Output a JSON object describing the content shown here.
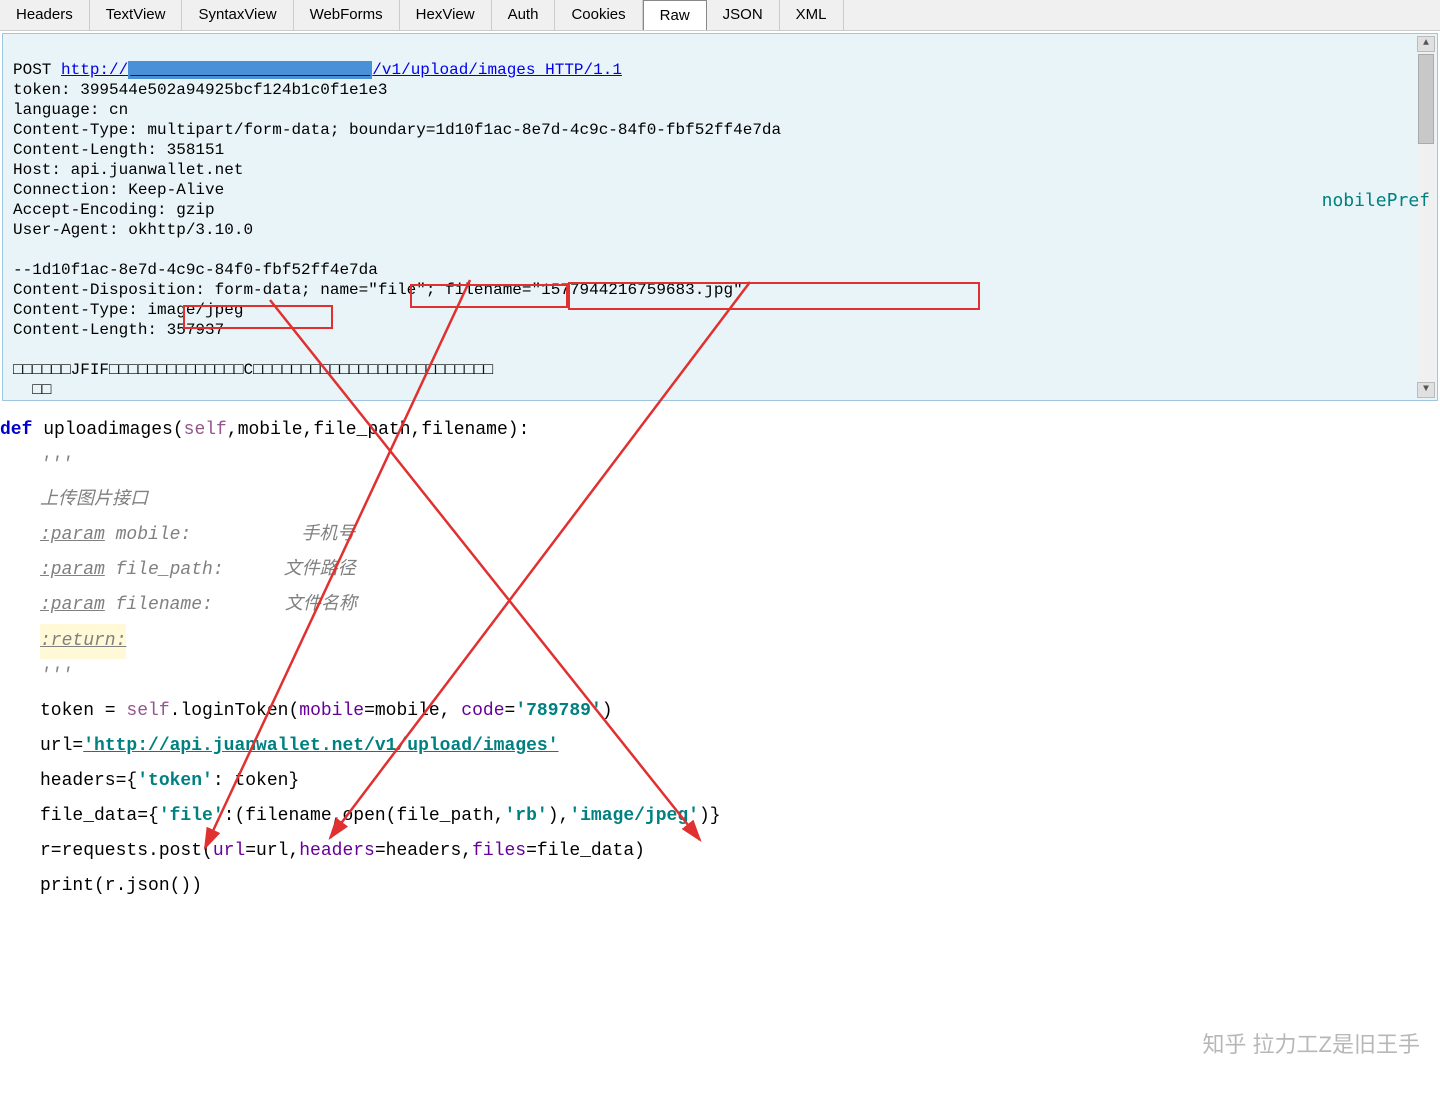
{
  "tabs": [
    {
      "label": "Headers"
    },
    {
      "label": "TextView"
    },
    {
      "label": "SyntaxView"
    },
    {
      "label": "WebForms"
    },
    {
      "label": "HexView"
    },
    {
      "label": "Auth"
    },
    {
      "label": "Cookies"
    },
    {
      "label": "Raw",
      "active": true
    },
    {
      "label": "JSON"
    },
    {
      "label": "XML"
    }
  ],
  "raw": {
    "method": "POST",
    "url_prefix": "http://",
    "url_hidden": "                         ",
    "url_path": "/v1/upload/images HTTP/1.1",
    "line_token": "token: 399544e502a94925bcf124b1c0f1e1e3",
    "line_lang": "language: cn",
    "line_ctype": "Content-Type: multipart/form-data; boundary=1d10f1ac-8e7d-4c9c-84f0-fbf52ff4e7da",
    "line_clen": "Content-Length: 358151",
    "line_host": "Host: api.juanwallet.net",
    "line_conn": "Connection: Keep-Alive",
    "line_enc": "Accept-Encoding: gzip",
    "line_ua": "User-Agent: okhttp/3.10.0",
    "line_blank": "",
    "line_boundary": "--1d10f1ac-8e7d-4c9c-84f0-fbf52ff4e7da",
    "line_disp_1": "Content-Disposition: form-data; ",
    "line_disp_name": "name=\"file\";",
    "line_disp_sp": " ",
    "line_disp_fname": "filename=\"1577944216759683.jpg\"",
    "line_ctype2_1": "Content-Type: ",
    "line_ctype2_val": "image/jpeg",
    "line_clen2": "Content-Length: 357937",
    "line_blank2": "",
    "line_jfif": "□□□□□□JFIF□□□□□□□□□□□□□□C□□□□□□□□□□□□□□□□□□□□□□□□□",
    "line_end": "  □□"
  },
  "side_text": "nobilePref",
  "code": {
    "def": "def",
    "fn": "uploadimages",
    "self": "self",
    "p1": "mobile",
    "p2": "file_path",
    "p3": "filename",
    "triple": "'''",
    "doc_title": "上传图片接口",
    "tag_param": ":param",
    "doc_p1": "mobile:",
    "doc_p1_desc": "手机号",
    "doc_p2": "file_path:",
    "doc_p2_desc": "文件路径",
    "doc_p3": "filename:",
    "doc_p3_desc": "文件名称",
    "ret": ":return:",
    "l_token": "token = ",
    "l_token_self": "self",
    "l_token_rest": ".loginToken(",
    "kw_mobile": "mobile",
    "eq_mobile": "=mobile, ",
    "kw_code": "code",
    "eq_code": "=",
    "str_code": "'789789'",
    "close_paren": ")",
    "l_url": "url=",
    "str_url": "'http://api.juanwallet.net/v1/upload/images'",
    "l_headers": "headers={",
    "str_token": "'token'",
    "l_headers2": ": token}",
    "l_fd": "file_data={",
    "str_file": "'file'",
    "l_fd2": ":(filename,open(file_path,",
    "str_rb": "'rb'",
    "l_fd3": "),",
    "str_ij": "'image/jpeg'",
    "l_fd4": ")}",
    "l_req": "r=requests.post(",
    "kw_url": "url",
    "eq_url": "=url,",
    "kw_headers": "headers",
    "eq_headers": "=headers,",
    "kw_files": "files",
    "eq_files": "=file_data)",
    "l_print": "print(r.json())"
  },
  "watermark": "知乎 拉力工Z是旧王手"
}
